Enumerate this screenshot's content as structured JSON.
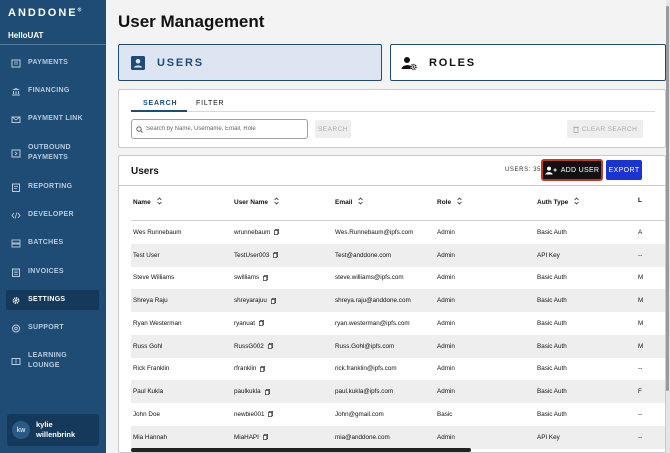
{
  "brand": {
    "logo": "ANDDONE",
    "org": "HelloUAT"
  },
  "sidebar": {
    "items": [
      {
        "label": "PAYMENTS",
        "icon": "payments-icon"
      },
      {
        "label": "FINANCING",
        "icon": "bank-icon"
      },
      {
        "label": "PAYMENT LINK",
        "icon": "mail-icon"
      },
      {
        "label": "OUTBOUND PAYMENTS",
        "icon": "outbound-icon"
      },
      {
        "label": "REPORTING",
        "icon": "report-icon"
      },
      {
        "label": "DEVELOPER",
        "icon": "code-icon"
      },
      {
        "label": "BATCHES",
        "icon": "batches-icon"
      },
      {
        "label": "INVOICES",
        "icon": "invoice-icon"
      },
      {
        "label": "SETTINGS",
        "icon": "gear-icon"
      },
      {
        "label": "SUPPORT",
        "icon": "support-icon"
      },
      {
        "label": "LEARNING LOUNGE",
        "icon": "learning-icon"
      }
    ],
    "active": "SETTINGS",
    "user": {
      "initials": "kw",
      "name": "kylie willenbrink"
    }
  },
  "page": {
    "title": "User Management"
  },
  "tabs": {
    "users": "USERS",
    "roles": "ROLES"
  },
  "search": {
    "tab_search": "SEARCH",
    "tab_filter": "FILTER",
    "placeholder": "Search by Name, Username, Email, Role",
    "search_button": "SEARCH",
    "clear_button": "CLEAR SEARCH"
  },
  "users_table": {
    "title": "Users",
    "count_label": "USERS: 35",
    "add_user": "ADD USER",
    "export": "EXPORT",
    "columns": [
      "Name",
      "User Name",
      "Email",
      "Role",
      "Auth Type",
      "L"
    ],
    "rows": [
      {
        "name": "Wes Runnebaum",
        "username": "wrunnebaum",
        "email": "Wes.Runnebaum@ipfs.com",
        "role": "Admin",
        "auth": "Basic Auth",
        "last": "A"
      },
      {
        "name": "Test User",
        "username": "TestUser003",
        "email": "Test@anddone.com",
        "role": "Admin",
        "auth": "API Key",
        "last": "--"
      },
      {
        "name": "Steve Williams",
        "username": "swilliams",
        "email": "steve.williams@ipfs.com",
        "role": "Admin",
        "auth": "Basic Auth",
        "last": "M"
      },
      {
        "name": "Shreya Raju",
        "username": "shreyarajuu",
        "email": "shreya.raju@anddone.com",
        "role": "Admin",
        "auth": "Basic Auth",
        "last": "M"
      },
      {
        "name": "Ryan Westerman",
        "username": "ryanuat",
        "email": "ryan.westerman@ipfs.com",
        "role": "Admin",
        "auth": "Basic Auth",
        "last": "M"
      },
      {
        "name": "Russ Gohl",
        "username": "RussG002",
        "email": "Russ.Gohl@ipfs.com",
        "role": "Admin",
        "auth": "Basic Auth",
        "last": "M"
      },
      {
        "name": "Rick Franklin",
        "username": "rfranklin",
        "email": "rick.franklin@ipfs.com",
        "role": "Admin",
        "auth": "Basic Auth",
        "last": "--"
      },
      {
        "name": "Paul Kukla",
        "username": "paulkukla",
        "email": "paul.kukla@ipfs.com",
        "role": "Admin",
        "auth": "Basic Auth",
        "last": "F"
      },
      {
        "name": "John Doe",
        "username": "newbie001",
        "email": "John@gmail.com",
        "role": "Basic",
        "auth": "Basic Auth",
        "last": "--"
      },
      {
        "name": "Mia Hannah",
        "username": "MiaHAPI",
        "email": "mia@anddone.com",
        "role": "Admin",
        "auth": "API Key",
        "last": "--"
      }
    ]
  },
  "colors": {
    "sidebar": "#1e4c74",
    "accent": "#1e4c74",
    "export": "#1a33d4",
    "add_user_border": "#c0392b"
  }
}
